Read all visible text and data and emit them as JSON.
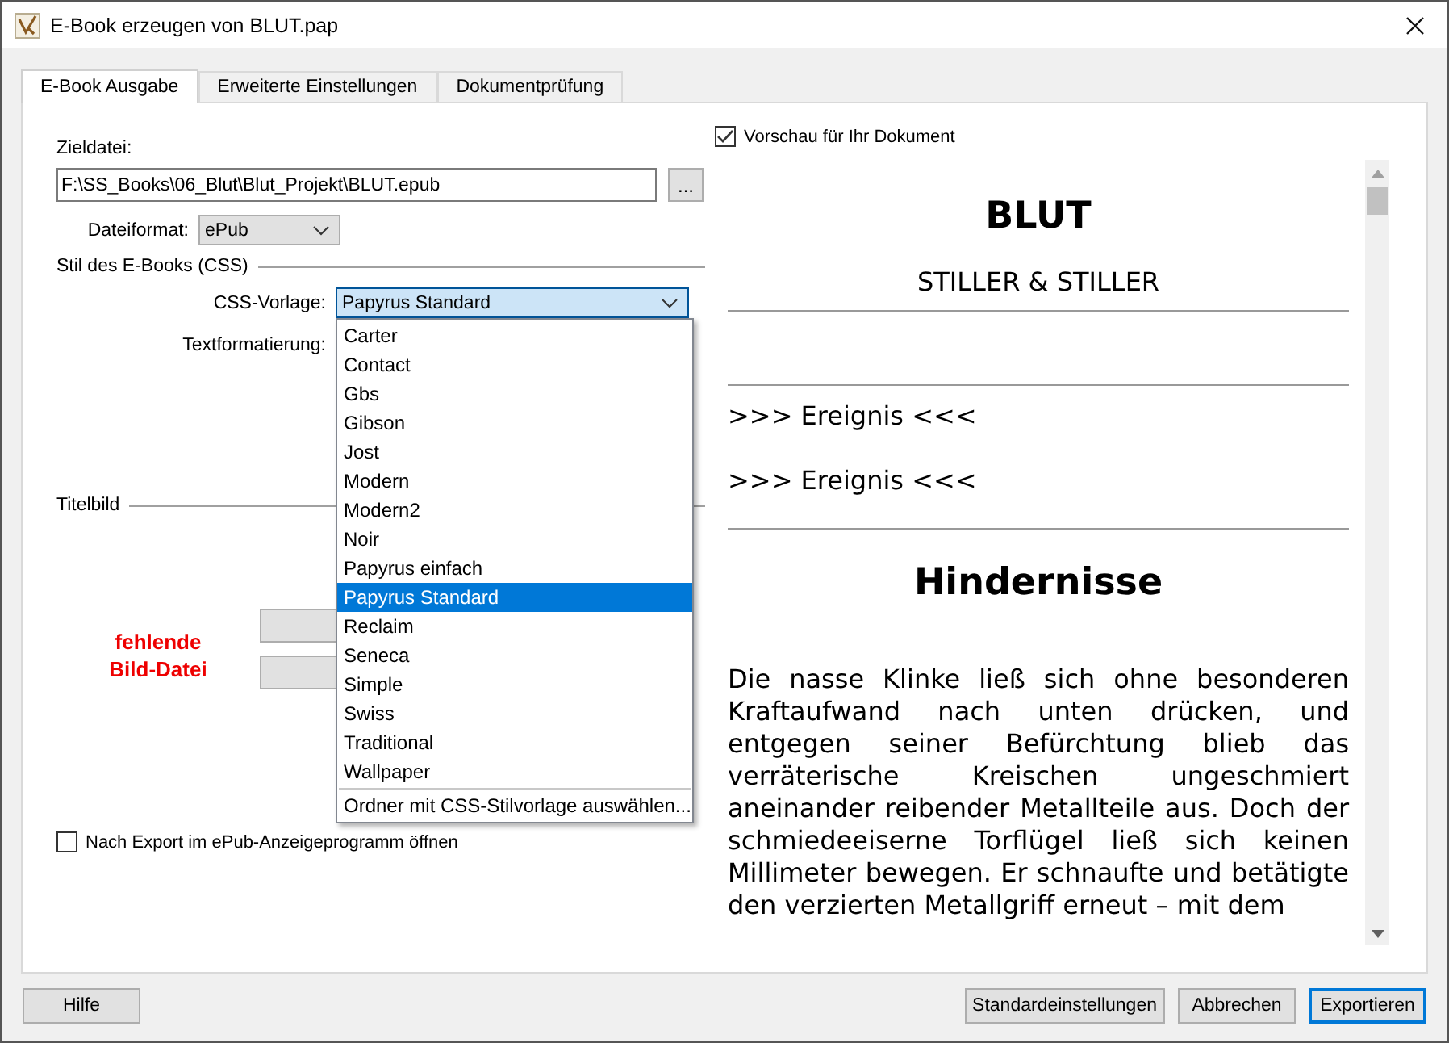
{
  "window": {
    "title": "E-Book erzeugen von BLUT.pap"
  },
  "tabs": [
    {
      "label": "E-Book Ausgabe",
      "selected": true
    },
    {
      "label": "Erweiterte Einstellungen",
      "selected": false
    },
    {
      "label": "Dokumentprüfung",
      "selected": false
    }
  ],
  "output": {
    "target_label": "Zieldatei:",
    "target_value": "F:\\SS_Books\\06_Blut\\Blut_Projekt\\BLUT.epub",
    "browse_button": "...",
    "format_label": "Dateiformat:",
    "format_value": "ePub",
    "css_section": "Stil des E-Books (CSS)",
    "css_label": "CSS-Vorlage:",
    "css_value": "Papyrus Standard",
    "textformat_label": "Textformatierung:",
    "title_image_section": "Titelbild",
    "missing_image": [
      "fehlende",
      "Bild-Datei"
    ],
    "open_after_export": {
      "label": "Nach Export im ePub-Anzeigeprogramm öffnen",
      "checked": false
    }
  },
  "dropdown": {
    "items": [
      {
        "label": "Carter",
        "selected": false
      },
      {
        "label": "Contact",
        "selected": false
      },
      {
        "label": "Gbs",
        "selected": false
      },
      {
        "label": "Gibson",
        "selected": false
      },
      {
        "label": "Jost",
        "selected": false
      },
      {
        "label": "Modern",
        "selected": false
      },
      {
        "label": "Modern2",
        "selected": false
      },
      {
        "label": "Noir",
        "selected": false
      },
      {
        "label": "Papyrus einfach",
        "selected": false
      },
      {
        "label": "Papyrus Standard",
        "selected": true
      },
      {
        "label": "Reclaim",
        "selected": false
      },
      {
        "label": "Seneca",
        "selected": false
      },
      {
        "label": "Simple",
        "selected": false
      },
      {
        "label": "Swiss",
        "selected": false
      },
      {
        "label": "Traditional",
        "selected": false
      },
      {
        "label": "Wallpaper",
        "selected": false
      }
    ],
    "action": "Ordner mit CSS-Stilvorlage auswählen..."
  },
  "preview": {
    "checkbox": {
      "label": "Vorschau für Ihr Dokument",
      "checked": true
    },
    "title": "BLUT",
    "author": "STILLER & STILLER",
    "events": [
      ">>> Ereignis <<<",
      ">>> Ereignis <<<"
    ],
    "chapter": "Hindernisse",
    "paragraph": "Die nasse Klinke ließ sich ohne besonderen Kraftaufwand nach unten drücken, und entgegen seiner Befürchtung blieb das verräterische Kreischen ungeschmiert aneinander reibender Metallteile aus. Doch der schmiedeeiserne Torflügel ließ sich keinen Millimeter bewegen. Er schnaufte und betätigte den verzierten Metallgriff erneut – mit dem"
  },
  "buttons": [
    {
      "label": "Hilfe",
      "default": false
    },
    {
      "label": "Standardeinstellungen",
      "default": false
    },
    {
      "label": "Abbrechen",
      "default": false
    },
    {
      "label": "Exportieren",
      "default": true
    }
  ]
}
